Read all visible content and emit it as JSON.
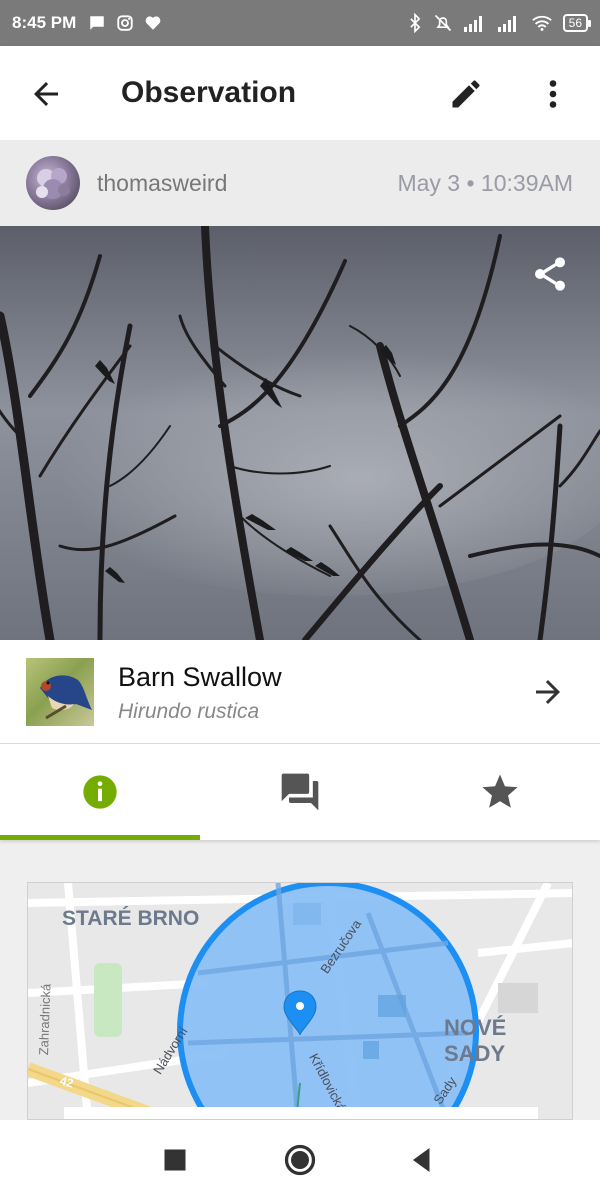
{
  "status_bar": {
    "time": "8:45 PM",
    "battery": "56"
  },
  "app_bar": {
    "title": "Observation"
  },
  "observation": {
    "username": "thomasweird",
    "date": "May 3 • 10:39AM"
  },
  "taxon": {
    "common_name": "Barn Swallow",
    "scientific_name": "Hirundo rustica"
  },
  "tabs": [
    {
      "icon": "info-icon",
      "active": true
    },
    {
      "icon": "comments-icon",
      "active": false
    },
    {
      "icon": "star-icon",
      "active": false
    }
  ],
  "map": {
    "labels": {
      "stare_brno": "STARÉ BRNO",
      "nove_sady": "NOVÉ SADY",
      "zahradnicka": "Zahradnická",
      "bezrucova": "Bezručova",
      "nadrazni": "Nádvorní",
      "kridlovicka": "Křídlovická",
      "sady": "Sady",
      "road_number": "42"
    },
    "accuracy_circle_color": "#1e8ff2",
    "pin_color": "#1e8ff2"
  },
  "colors": {
    "accent": "#74ac00",
    "status_bar": "#7a7a7a"
  },
  "nav": {
    "buttons": [
      "recents-icon",
      "home-icon",
      "back-icon"
    ]
  }
}
